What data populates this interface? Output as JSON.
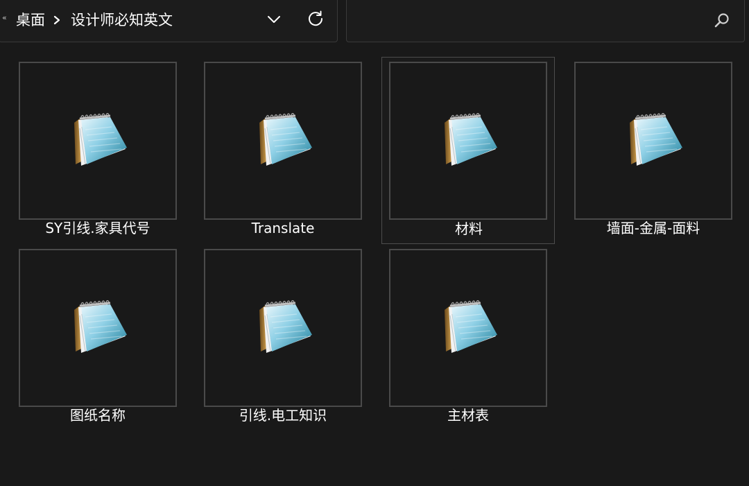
{
  "address_bar": {
    "overflow_glyph": "«",
    "breadcrumb_root": "桌面",
    "breadcrumb_separator_icon": "chevron-right-icon",
    "breadcrumb_current": "设计师必知英文",
    "history_dropdown_icon": "chevron-down-icon",
    "refresh_icon": "refresh-icon"
  },
  "search": {
    "value": "",
    "placeholder": "",
    "icon": "search-icon"
  },
  "files": [
    {
      "name": "SY引线.家具代号",
      "icon": "notepad-icon",
      "selected": false
    },
    {
      "name": "Translate",
      "icon": "notepad-icon",
      "selected": false
    },
    {
      "name": "材料",
      "icon": "notepad-icon",
      "selected": true
    },
    {
      "name": "墙面-金属-面料",
      "icon": "notepad-icon",
      "selected": false
    },
    {
      "name": "图纸名称",
      "icon": "notepad-icon",
      "selected": false
    },
    {
      "name": "引线.电工知识",
      "icon": "notepad-icon",
      "selected": false
    },
    {
      "name": "主材表",
      "icon": "notepad-icon",
      "selected": false
    }
  ],
  "colors": {
    "background": "#191919",
    "border": "#4a4a4a",
    "text": "#ffffff"
  }
}
